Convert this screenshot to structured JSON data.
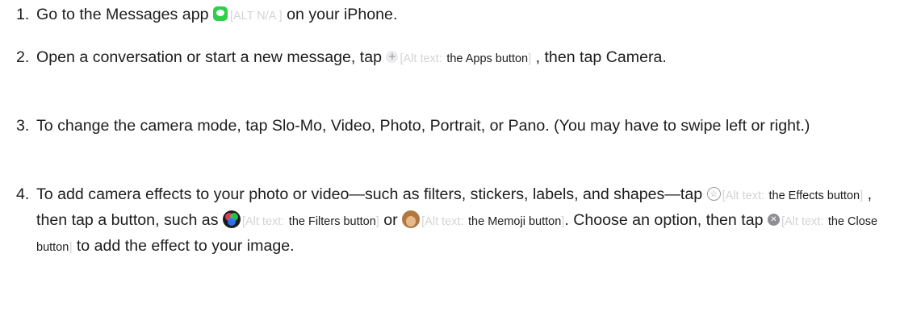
{
  "steps": [
    {
      "number": "1.",
      "t1": "Go to the Messages app",
      "alt_text": "[ALT N/A ]",
      "t2": "on your iPhone."
    },
    {
      "number": "2.",
      "t1": "Open a conversation or start a new message, tap",
      "alt_prefix": "[Alt text:",
      "alt_value": "the Apps button",
      "alt_close": "]",
      "t2": ", then tap Camera."
    },
    {
      "number": "3.",
      "t1": "To change the camera mode, tap Slo-Mo, Video, Photo, Portrait, or Pano. (You may have to swipe left or right.)"
    },
    {
      "number": "4.",
      "t1": "To add camera effects to your photo or video—such as filters, stickers, labels, and shapes—tap",
      "alt1_prefix": "[Alt text:",
      "alt1_value": "the Effects button",
      "alt1_close": "]",
      "t2": ", then tap a button, such as",
      "alt2_prefix": "[Alt text:",
      "alt2_value": "the Filters button",
      "alt2_close": "]",
      "t3": "or",
      "alt3_prefix": "[Alt text:",
      "alt3_value": "the Memoji button",
      "alt3_close": "]",
      "t4": ". Choose an option, then tap",
      "alt4_prefix": "[Alt text:",
      "alt4_value": "the Close button",
      "alt4_close": "]",
      "t5": "to add the effect to your image."
    }
  ],
  "icons": {
    "step1": "messages-app-icon",
    "step2": "apps-plus-icon",
    "step4_effects": "effects-star-icon",
    "step4_filters": "filters-icon",
    "step4_memoji": "memoji-icon",
    "step4_close": "close-x-icon"
  },
  "colors": {
    "text": "#1d1d1f",
    "alt_text": "#d4d4d6",
    "messages_green": "#2fcf4b"
  }
}
